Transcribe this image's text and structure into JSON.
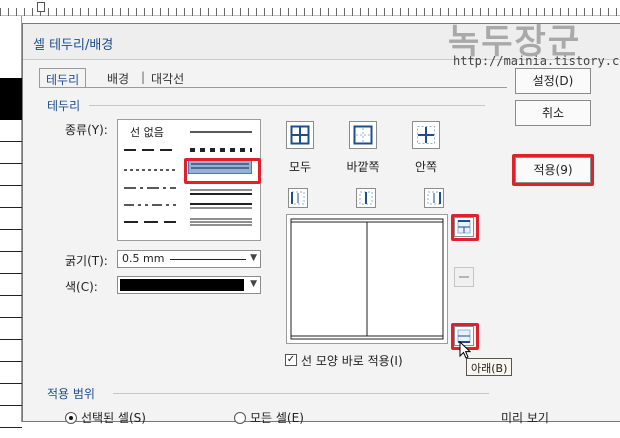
{
  "watermark": {
    "brand": "녹두장군",
    "url": "http://mainia.tistory.com"
  },
  "dialog": {
    "title": "셀 테두리/배경",
    "tabs": [
      {
        "label": "테두리"
      },
      {
        "label": "배경"
      },
      {
        "label": "대각선"
      }
    ],
    "tab_separator": "|"
  },
  "border_section": {
    "heading": "테두리",
    "type_label": "종류(Y):",
    "no_line_label": "선 없음",
    "thickness_label": "굵기(T):",
    "thickness_value": "0.5 mm",
    "color_label": "색(C):",
    "color_value": "#000000"
  },
  "preset_buttons": [
    {
      "label": "모두",
      "icon": "all-borders-icon"
    },
    {
      "label": "바깥쪽",
      "icon": "outside-borders-icon"
    },
    {
      "label": "안쪽",
      "icon": "inside-borders-icon"
    }
  ],
  "apply_checkbox": {
    "label": "선 모양 바로 적용(I)",
    "checked": true
  },
  "tooltip": "아래(B)",
  "scope_section": {
    "heading": "적용 범위",
    "options": [
      {
        "label": "선택된 셀(S)",
        "selected": true
      },
      {
        "label": "모든 셀(E)",
        "selected": false
      }
    ],
    "preview_label": "미리 보기"
  },
  "buttons": {
    "ok": "설정(D)",
    "cancel": "취소",
    "apply": "적용(9)"
  },
  "colors": {
    "highlight": "#e0212b",
    "title": "#1c4f8f",
    "selection": "#8fb3dc"
  }
}
